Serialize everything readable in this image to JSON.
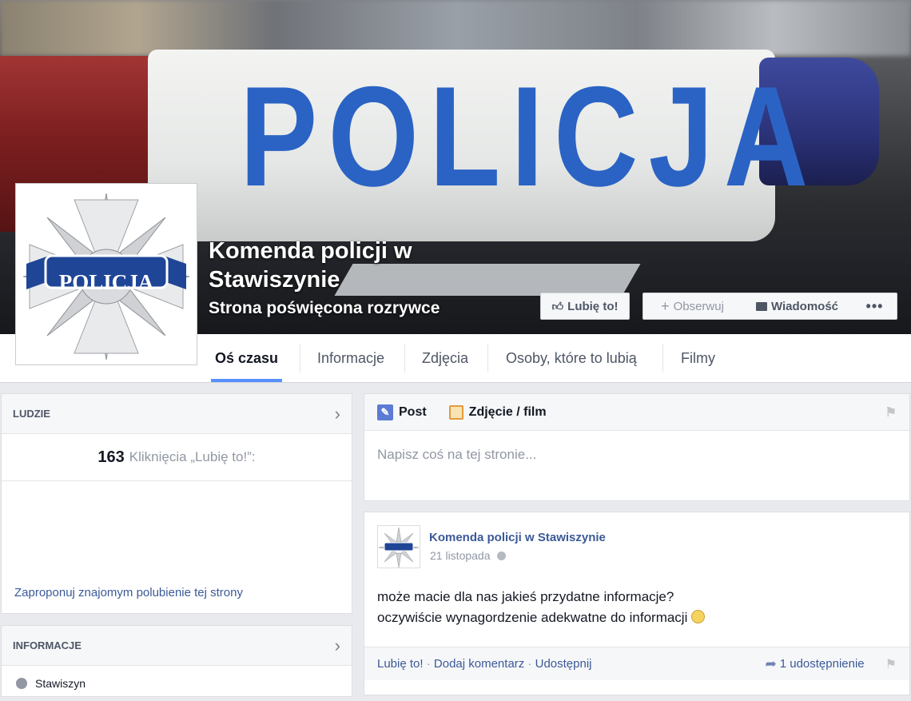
{
  "cover": {
    "lightbar_text": "POLICJA",
    "page_name": "Komenda policji w Stawiszynie",
    "page_category": "Strona poświęcona rozrywce"
  },
  "profile_pic": {
    "badge_text": "POLICJA"
  },
  "actions": {
    "like": "Lubię to!",
    "follow": "Obserwuj",
    "message": "Wiadomość",
    "more": "•••"
  },
  "tabs": [
    {
      "label": "Oś czasu",
      "active": true
    },
    {
      "label": "Informacje"
    },
    {
      "label": "Zdjęcia"
    },
    {
      "label": "Osoby, które to lubią"
    },
    {
      "label": "Filmy"
    }
  ],
  "people": {
    "header": "LUDZIE",
    "likes_count": "163",
    "likes_label": "Kliknięcia „Lubię to!”:",
    "invite_link": "Zaproponuj znajomym polubienie tej strony"
  },
  "info": {
    "header": "INFORMACJE",
    "location": "Stawiszyn"
  },
  "composer": {
    "post_tab": "Post",
    "photo_tab": "Zdjęcie / film",
    "placeholder": "Napisz coś na tej stronie..."
  },
  "post": {
    "author": "Komenda policji w Stawiszynie",
    "date": "21 listopada",
    "line1": "może macie dla nas jakieś przydatne informacje?",
    "line2": "oczywiście wynagordzenie adekwatne do informacji",
    "like": "Lubię to!",
    "comment": "Dodaj komentarz",
    "share": "Udostępnij",
    "shares": "1 udostępnienie"
  }
}
